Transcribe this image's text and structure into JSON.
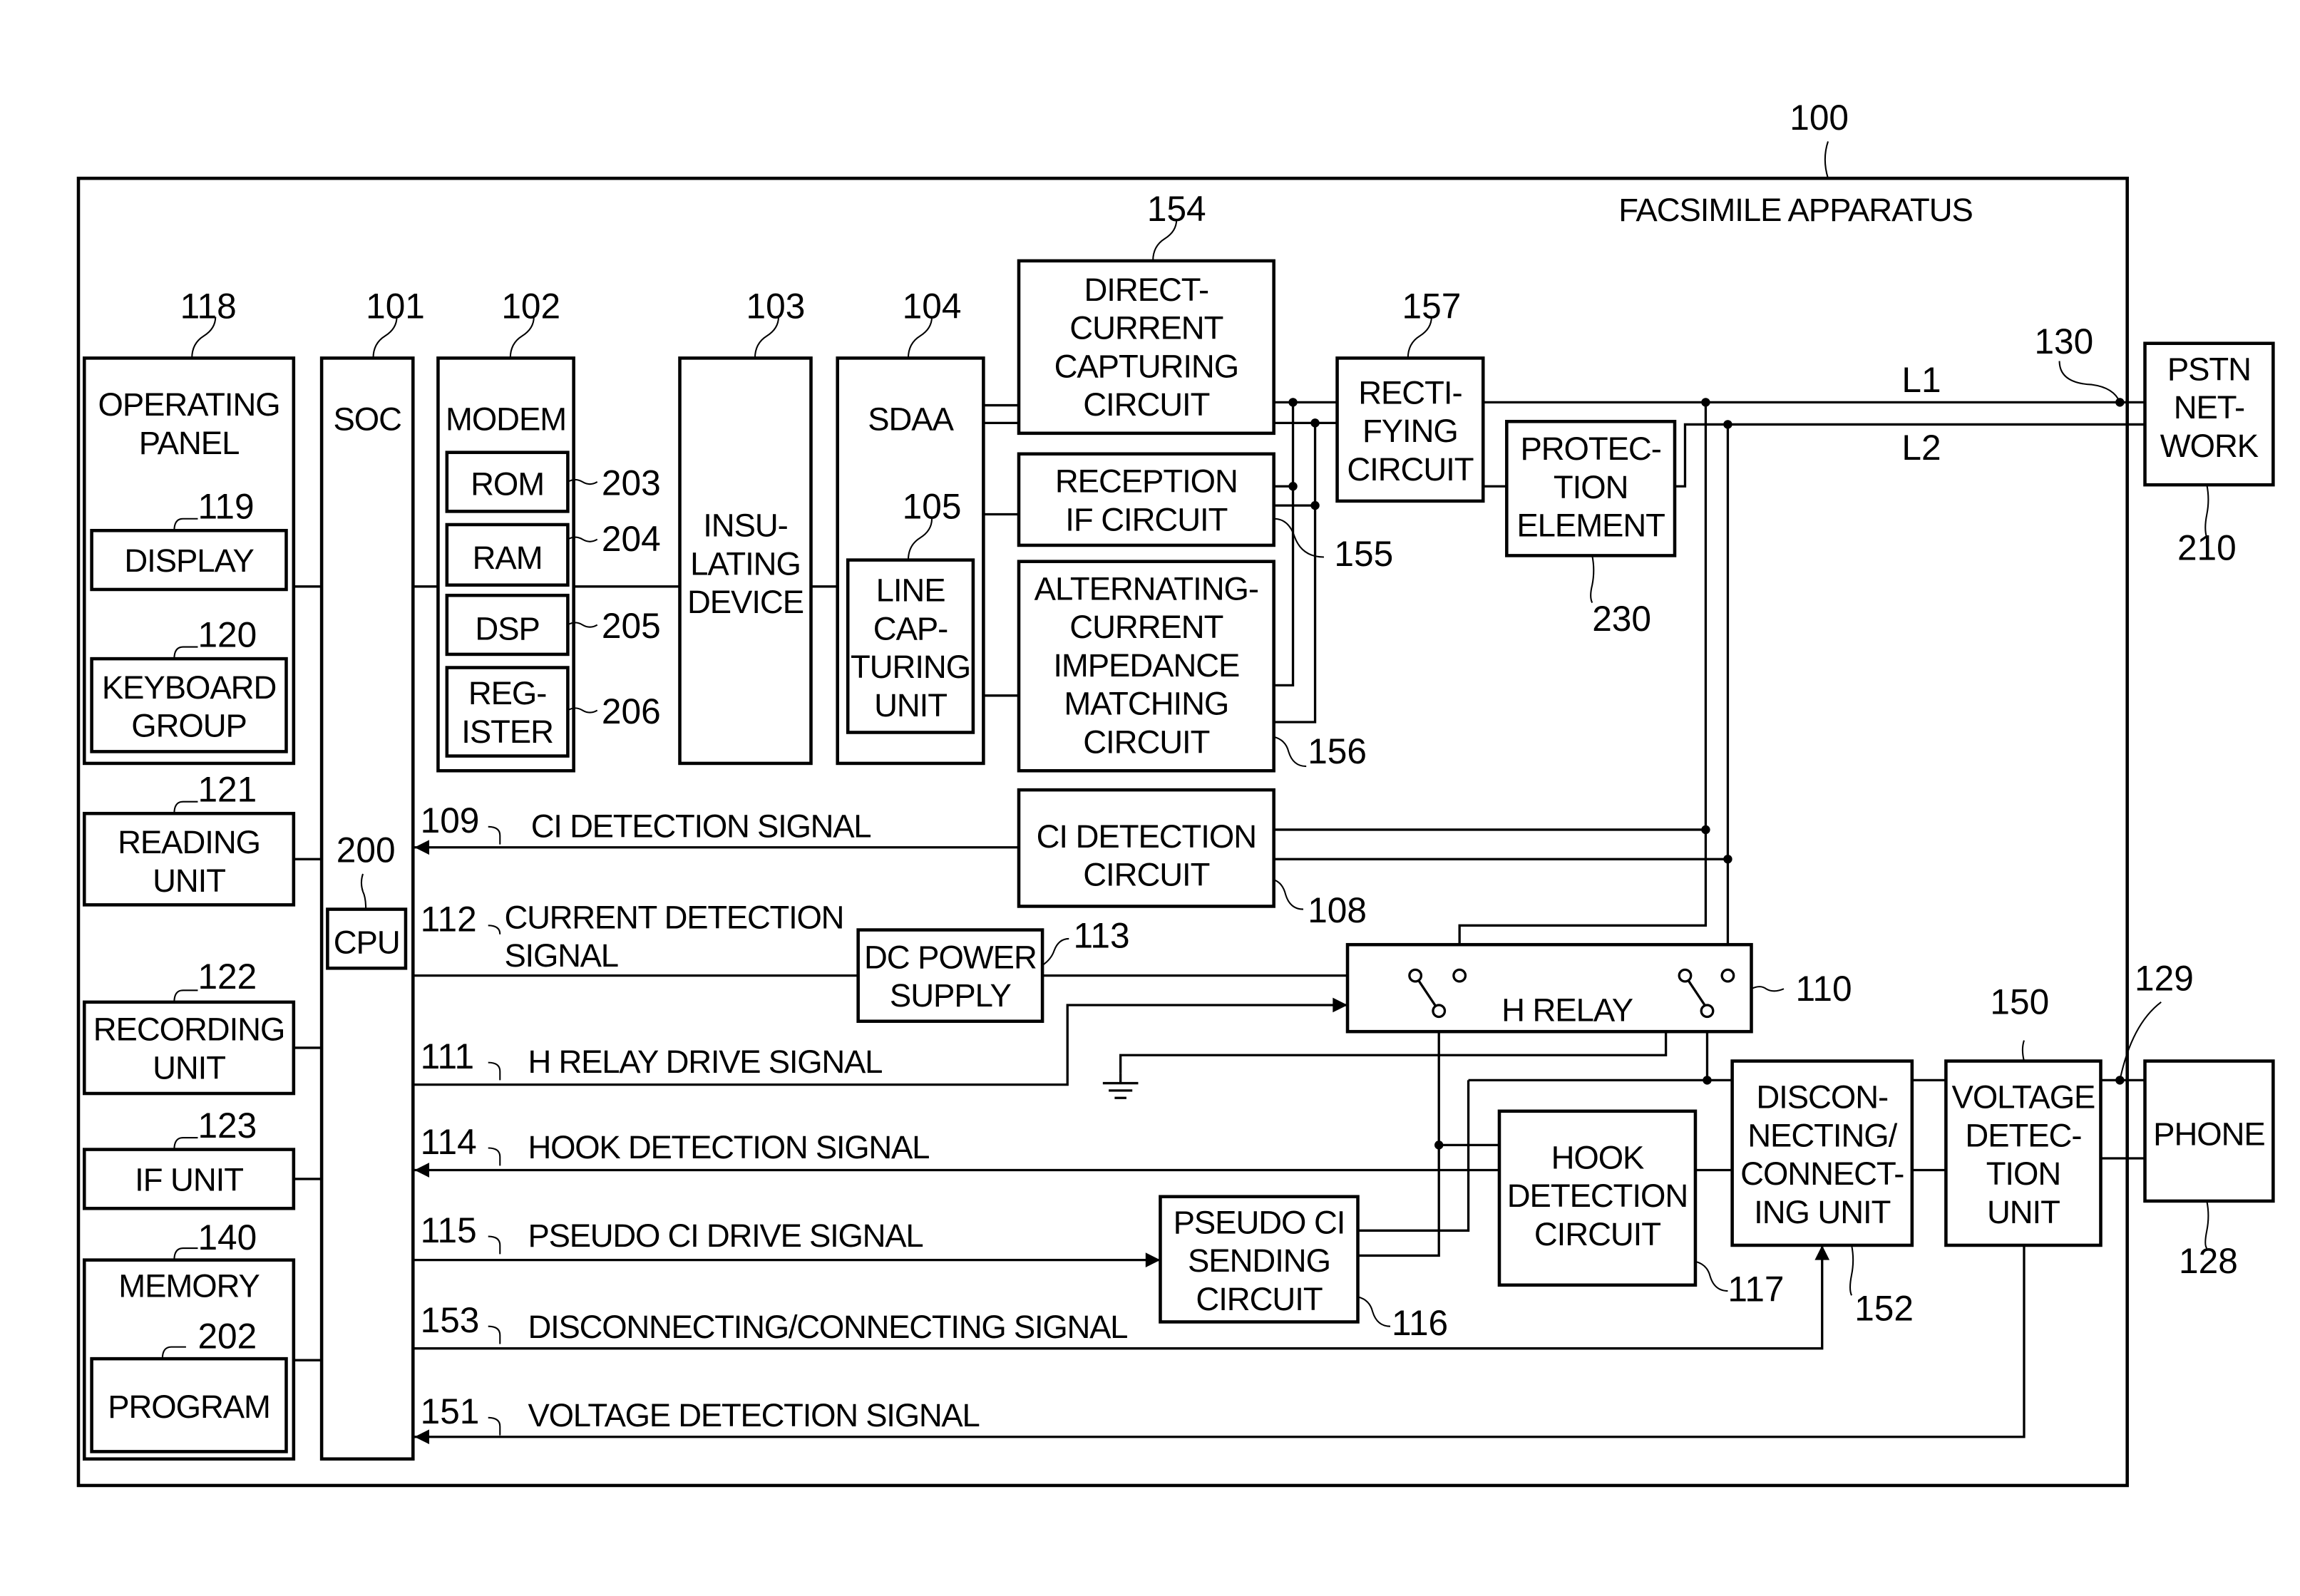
{
  "apparatus": {
    "ref": "100",
    "title": "FACSIMILE APPARATUS"
  },
  "blocks": {
    "operating_panel": {
      "ref": "118",
      "lines": [
        "OPERATING",
        "PANEL"
      ]
    },
    "display": {
      "ref": "119",
      "lines": [
        "DISPLAY"
      ]
    },
    "keyboard_group": {
      "ref": "120",
      "lines": [
        "KEYBOARD",
        "GROUP"
      ]
    },
    "reading_unit": {
      "ref": "121",
      "lines": [
        "READING",
        "UNIT"
      ]
    },
    "recording_unit": {
      "ref": "122",
      "lines": [
        "RECORDING",
        "UNIT"
      ]
    },
    "if_unit": {
      "ref": "123",
      "lines": [
        "IF UNIT"
      ]
    },
    "memory": {
      "ref": "140",
      "lines": [
        "MEMORY"
      ]
    },
    "program": {
      "ref": "202",
      "lines": [
        "PROGRAM"
      ]
    },
    "soc": {
      "ref": "101",
      "lines": [
        "SOC"
      ]
    },
    "cpu": {
      "ref": "200",
      "lines": [
        "CPU"
      ]
    },
    "modem": {
      "ref": "102",
      "lines": [
        "MODEM"
      ]
    },
    "rom": {
      "ref": "203",
      "lines": [
        "ROM"
      ]
    },
    "ram": {
      "ref": "204",
      "lines": [
        "RAM"
      ]
    },
    "dsp": {
      "ref": "205",
      "lines": [
        "DSP"
      ]
    },
    "register": {
      "ref": "206",
      "lines": [
        "REG-",
        "ISTER"
      ]
    },
    "insulating_device": {
      "ref": "103",
      "lines": [
        "INSU-",
        "LATING",
        "DEVICE"
      ]
    },
    "sdaa": {
      "ref": "104",
      "lines": [
        "SDAA"
      ]
    },
    "line_capturing_unit": {
      "ref": "105",
      "lines": [
        "LINE",
        "CAP-",
        "TURING",
        "UNIT"
      ]
    },
    "dc_capturing_circuit": {
      "ref": "154",
      "lines": [
        "DIRECT-",
        "CURRENT",
        "CAPTURING",
        "CIRCUIT"
      ]
    },
    "reception_if_circuit": {
      "ref": "155",
      "lines": [
        "RECEPTION",
        "IF CIRCUIT"
      ]
    },
    "ac_impedance_matching_circuit": {
      "ref": "156",
      "lines": [
        "ALTERNATING-",
        "CURRENT",
        "IMPEDANCE",
        "MATCHING",
        "CIRCUIT"
      ]
    },
    "rectifying_circuit": {
      "ref": "157",
      "lines": [
        "RECTI-",
        "FYING",
        "CIRCUIT"
      ]
    },
    "protection_element": {
      "ref": "230",
      "lines": [
        "PROTEC-",
        "TION",
        "ELEMENT"
      ]
    },
    "pstn_network": {
      "ref": "210",
      "lines": [
        "PSTN",
        "NET-",
        "WORK"
      ]
    },
    "ci_detection_circuit": {
      "ref": "108",
      "lines": [
        "CI DETECTION",
        "CIRCUIT"
      ]
    },
    "dc_power_supply": {
      "ref": "113",
      "lines": [
        "DC POWER",
        "SUPPLY"
      ]
    },
    "h_relay": {
      "ref": "110",
      "lines": [
        "H RELAY"
      ]
    },
    "pseudo_ci_sending_circuit": {
      "ref": "116",
      "lines": [
        "PSEUDO CI",
        "SENDING",
        "CIRCUIT"
      ]
    },
    "hook_detection_circuit": {
      "ref": "117",
      "lines": [
        "HOOK",
        "DETECTION",
        "CIRCUIT"
      ]
    },
    "disconnecting_connecting_unit": {
      "ref": "152",
      "lines": [
        "DISCON-",
        "NECTING/",
        "CONNECT-",
        "ING UNIT"
      ]
    },
    "voltage_detection_unit": {
      "ref": "150",
      "lines": [
        "VOLTAGE",
        "DETEC-",
        "TION",
        "UNIT"
      ]
    },
    "phone": {
      "ref": "128",
      "lines": [
        "PHONE"
      ]
    }
  },
  "lines": {
    "l1": "L1",
    "l2": "L2",
    "pstn_junction_ref": "130",
    "phone_junction_ref": "129"
  },
  "signals": [
    {
      "ref": "109",
      "label": "CI DETECTION SIGNAL",
      "direction": "to-soc"
    },
    {
      "ref": "112",
      "label": "CURRENT DETECTION SIGNAL",
      "label_lines": [
        "CURRENT DETECTION",
        "SIGNAL"
      ],
      "direction": "none"
    },
    {
      "ref": "111",
      "label": "H RELAY DRIVE SIGNAL",
      "direction": "from-soc"
    },
    {
      "ref": "114",
      "label": "HOOK DETECTION SIGNAL",
      "direction": "to-soc"
    },
    {
      "ref": "115",
      "label": "PSEUDO CI DRIVE SIGNAL",
      "direction": "from-soc"
    },
    {
      "ref": "153",
      "label": "DISCONNECTING/CONNECTING SIGNAL",
      "direction": "from-soc"
    },
    {
      "ref": "151",
      "label": "VOLTAGE DETECTION SIGNAL",
      "direction": "to-soc"
    }
  ],
  "icons": {
    "ground": "ground-symbol",
    "junction": "junction-dot",
    "relay_contact": "relay-contact-terminal"
  }
}
